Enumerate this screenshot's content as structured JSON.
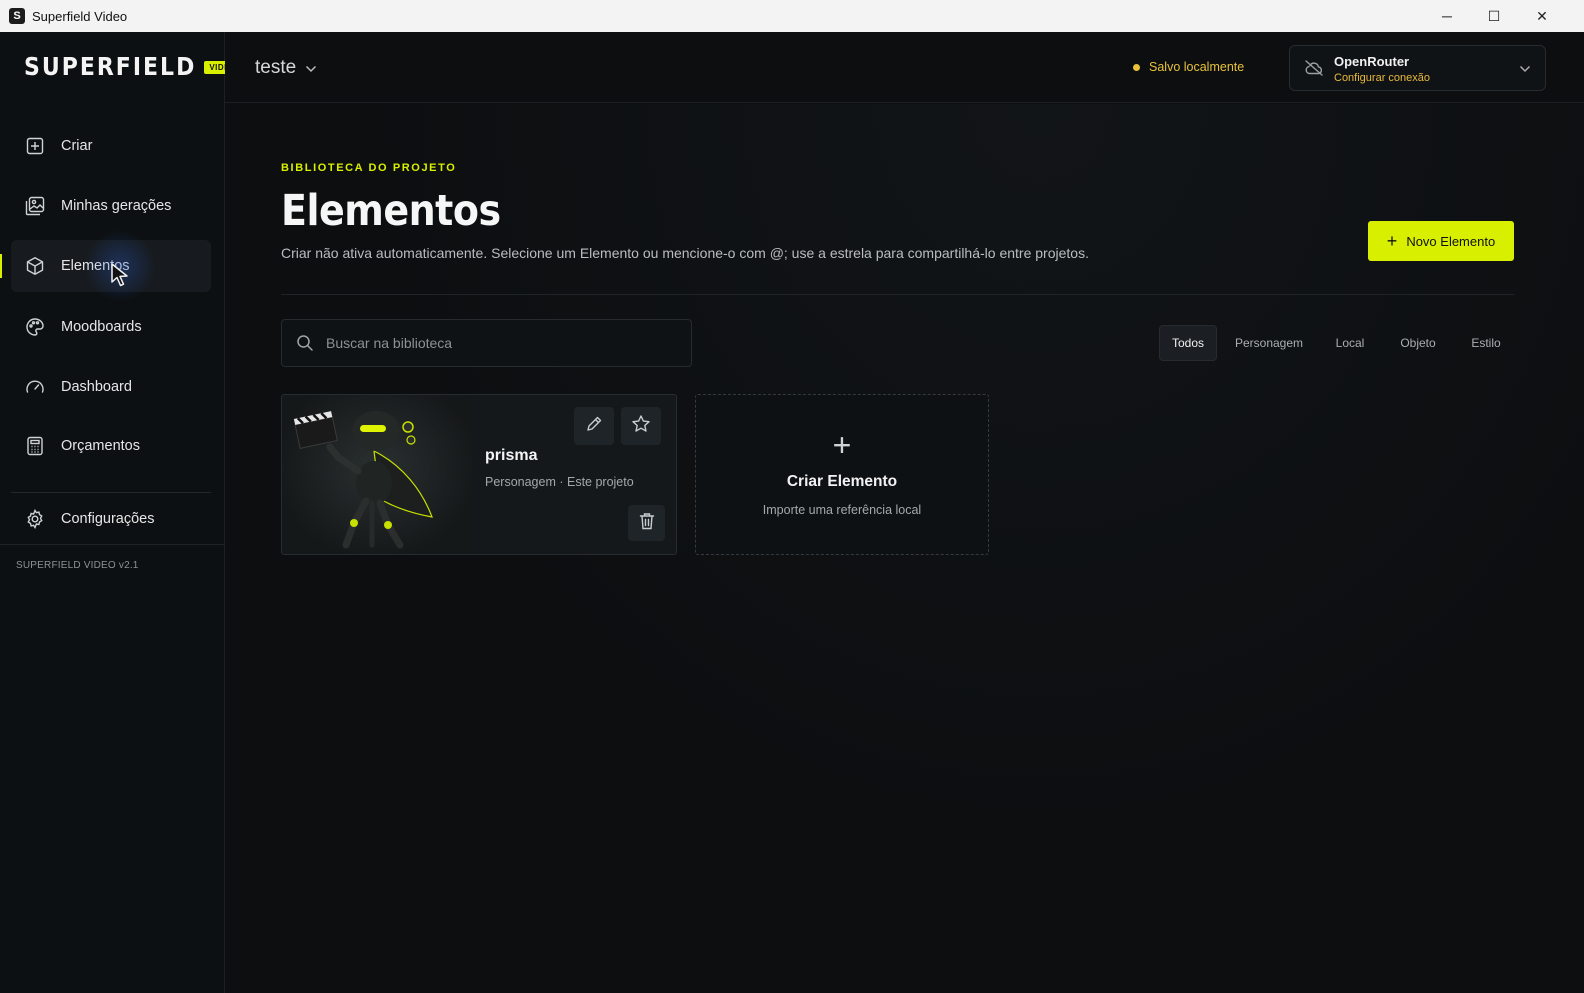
{
  "window": {
    "title": "Superfield Video",
    "minimize": "─",
    "maximize": "☐",
    "close": "✕"
  },
  "brand": {
    "name": "SUPERFIELD",
    "badge": "VIDEO"
  },
  "sidebar": {
    "items": [
      {
        "label": "Criar",
        "icon": "plus-square-icon"
      },
      {
        "label": "Minhas gerações",
        "icon": "gallery-icon"
      },
      {
        "label": "Elementos",
        "icon": "cube-icon",
        "active": true
      },
      {
        "label": "Moodboards",
        "icon": "palette-icon"
      },
      {
        "label": "Dashboard",
        "icon": "gauge-icon"
      },
      {
        "label": "Orçamentos",
        "icon": "calculator-icon"
      }
    ],
    "settings_label": "Configurações",
    "version": "SUPERFIELD VIDEO v2.1"
  },
  "topbar": {
    "project_name": "teste",
    "save_status": "Salvo localmente",
    "connection": {
      "name": "OpenRouter",
      "action": "Configurar conexão"
    }
  },
  "main": {
    "eyebrow": "BIBLIOTECA DO PROJETO",
    "title": "Elementos",
    "subtitle": "Criar não ativa automaticamente. Selecione um Elemento ou mencione-o com @; use a estrela para compartilhá-lo entre projetos.",
    "new_button": "Novo Elemento",
    "search_placeholder": "Buscar na biblioteca",
    "filters": [
      "Todos",
      "Personagem",
      "Local",
      "Objeto",
      "Estilo"
    ],
    "active_filter": "Todos",
    "elements": [
      {
        "name": "prisma",
        "meta": "Personagem · Este projeto"
      }
    ],
    "create_card": {
      "plus": "+",
      "title": "Criar Elemento",
      "subtitle": "Importe uma referência local"
    }
  },
  "colors": {
    "accent": "#d8f000",
    "saved": "#e9c23a",
    "background": "#0c0e10"
  }
}
